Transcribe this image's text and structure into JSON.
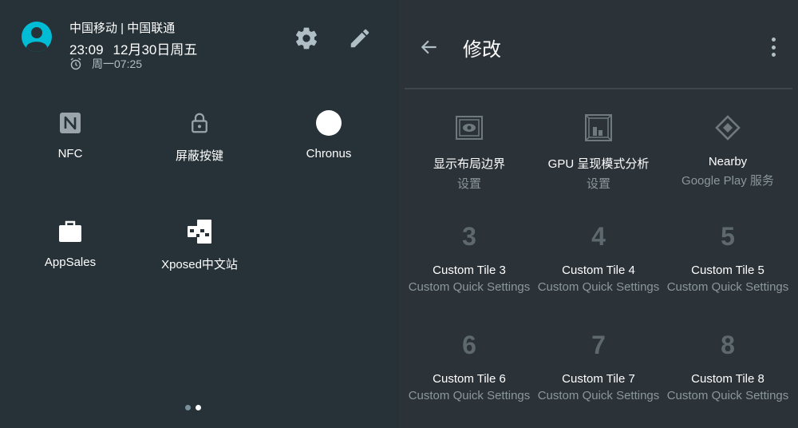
{
  "status": {
    "carrier": "中国移动 | 中国联通",
    "time": "23:09",
    "date": "12月30日周五",
    "alarm": "周一07:25"
  },
  "tiles": [
    {
      "label": "NFC",
      "icon": "nfc-icon"
    },
    {
      "label": "屏蔽按键",
      "icon": "lock-icon"
    },
    {
      "label": "Chronus",
      "icon": "circle-icon"
    },
    {
      "label": "AppSales",
      "icon": "briefcase-icon"
    },
    {
      "label": "Xposed中文站",
      "icon": "puzzle-icon"
    }
  ],
  "edit": {
    "title": "修改",
    "tiles": [
      {
        "label": "显示布局边界",
        "sub": "设置",
        "icon": "layout-bounds-icon"
      },
      {
        "label": "GPU 呈现模式分析",
        "sub": "设置",
        "icon": "gpu-profile-icon"
      },
      {
        "label": "Nearby",
        "sub": "Google Play 服务",
        "icon": "nearby-icon"
      },
      {
        "num": "3",
        "label": "Custom Tile 3",
        "sub": "Custom Quick Settings"
      },
      {
        "num": "4",
        "label": "Custom Tile 4",
        "sub": "Custom Quick Settings"
      },
      {
        "num": "5",
        "label": "Custom Tile 5",
        "sub": "Custom Quick Settings"
      },
      {
        "num": "6",
        "label": "Custom Tile 6",
        "sub": "Custom Quick Settings"
      },
      {
        "num": "7",
        "label": "Custom Tile 7",
        "sub": "Custom Quick Settings"
      },
      {
        "num": "8",
        "label": "Custom Tile 8",
        "sub": "Custom Quick Settings"
      }
    ]
  },
  "pager": {
    "count": 2,
    "active": 2
  },
  "colors": {
    "accent": "#00bcd4",
    "background": "#263238",
    "muted": "#8b979e"
  }
}
